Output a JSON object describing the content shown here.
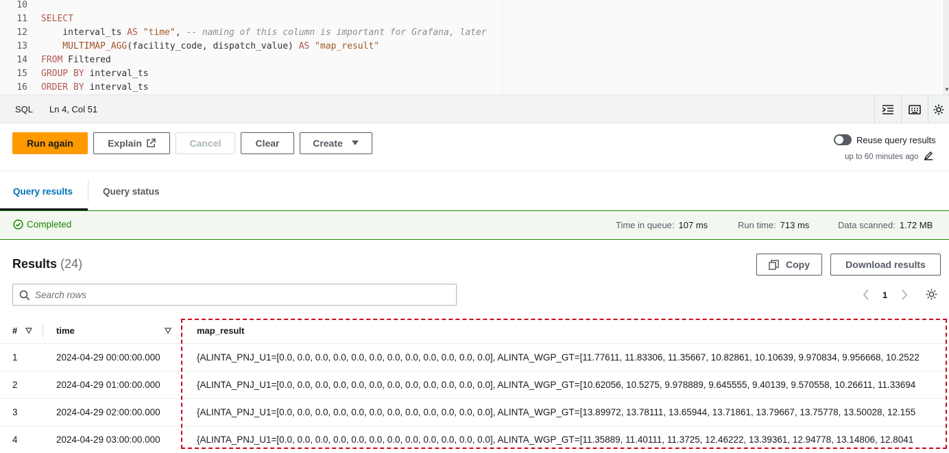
{
  "editor": {
    "lines": [
      {
        "num": "10",
        "tokens": []
      },
      {
        "num": "11",
        "tokens": [
          {
            "t": "SELECT",
            "c": "kw"
          }
        ]
      },
      {
        "num": "12",
        "tokens": [
          {
            "t": "    interval_ts ",
            "c": "plain"
          },
          {
            "t": "AS",
            "c": "kw"
          },
          {
            "t": " \"time\"",
            "c": "str"
          },
          {
            "t": ", ",
            "c": "plain"
          },
          {
            "t": "-- naming of this column is important for Grafana, later",
            "c": "cm"
          }
        ]
      },
      {
        "num": "13",
        "tokens": [
          {
            "t": "    MULTIMAP_AGG",
            "c": "fn"
          },
          {
            "t": "(facility_code, dispatch_value) ",
            "c": "plain"
          },
          {
            "t": "AS",
            "c": "kw"
          },
          {
            "t": " \"map_result\"",
            "c": "str"
          }
        ]
      },
      {
        "num": "14",
        "tokens": [
          {
            "t": "FROM",
            "c": "kw"
          },
          {
            "t": " Filtered",
            "c": "plain"
          }
        ]
      },
      {
        "num": "15",
        "tokens": [
          {
            "t": "GROUP BY",
            "c": "kw"
          },
          {
            "t": " interval_ts",
            "c": "plain"
          }
        ]
      },
      {
        "num": "16",
        "tokens": [
          {
            "t": "ORDER BY",
            "c": "kw"
          },
          {
            "t": " interval_ts",
            "c": "plain"
          }
        ]
      }
    ]
  },
  "statusbar": {
    "language": "SQL",
    "position": "Ln 4, Col 51",
    "icons": [
      "indent-icon",
      "keyboard-icon",
      "gear-icon"
    ]
  },
  "toolbar": {
    "run_again": "Run again",
    "explain": "Explain",
    "cancel": "Cancel",
    "clear": "Clear",
    "create": "Create",
    "reuse_label": "Reuse query results",
    "reuse_sub": "up to 60 minutes ago",
    "reuse_enabled": false
  },
  "tabs": {
    "active": "Query results",
    "inactive": "Query status"
  },
  "status": {
    "state": "Completed",
    "queue_label": "Time in queue:",
    "queue_value": "107 ms",
    "run_label": "Run time:",
    "run_value": "713 ms",
    "scanned_label": "Data scanned:",
    "scanned_value": "1.72 MB"
  },
  "results": {
    "title": "Results",
    "count": "(24)",
    "copy": "Copy",
    "download": "Download results",
    "search_placeholder": "Search rows",
    "page": "1"
  },
  "table": {
    "columns": [
      "#",
      "time",
      "map_result"
    ],
    "rows": [
      {
        "n": "1",
        "time": "2024-04-29 00:00:00.000",
        "map": "{ALINTA_PNJ_U1=[0.0, 0.0, 0.0, 0.0, 0.0, 0.0, 0.0, 0.0, 0.0, 0.0, 0.0, 0.0], ALINTA_WGP_GT=[11.77611, 11.83306, 11.35667, 10.82861, 10.10639, 9.970834, 9.956668, 10.2522"
      },
      {
        "n": "2",
        "time": "2024-04-29 01:00:00.000",
        "map": "{ALINTA_PNJ_U1=[0.0, 0.0, 0.0, 0.0, 0.0, 0.0, 0.0, 0.0, 0.0, 0.0, 0.0, 0.0], ALINTA_WGP_GT=[10.62056, 10.5275, 9.978889, 9.645555, 9.40139, 9.570558, 10.26611, 11.33694"
      },
      {
        "n": "3",
        "time": "2024-04-29 02:00:00.000",
        "map": "{ALINTA_PNJ_U1=[0.0, 0.0, 0.0, 0.0, 0.0, 0.0, 0.0, 0.0, 0.0, 0.0, 0.0, 0.0], ALINTA_WGP_GT=[13.89972, 13.78111, 13.65944, 13.71861, 13.79667, 13.75778, 13.50028, 12.155"
      },
      {
        "n": "4",
        "time": "2024-04-29 03:00:00.000",
        "map": "{ALINTA_PNJ_U1=[0.0, 0.0, 0.0, 0.0, 0.0, 0.0, 0.0, 0.0, 0.0, 0.0, 0.0, 0.0], ALINTA_WGP_GT=[11.35889, 11.40111, 11.3725, 12.46222, 13.39361, 12.94778, 13.14806, 12.8041"
      }
    ]
  },
  "colors": {
    "primary": "#ff9900",
    "success": "#1d8102",
    "link": "#0073bb",
    "highlight": "#d0021b"
  }
}
